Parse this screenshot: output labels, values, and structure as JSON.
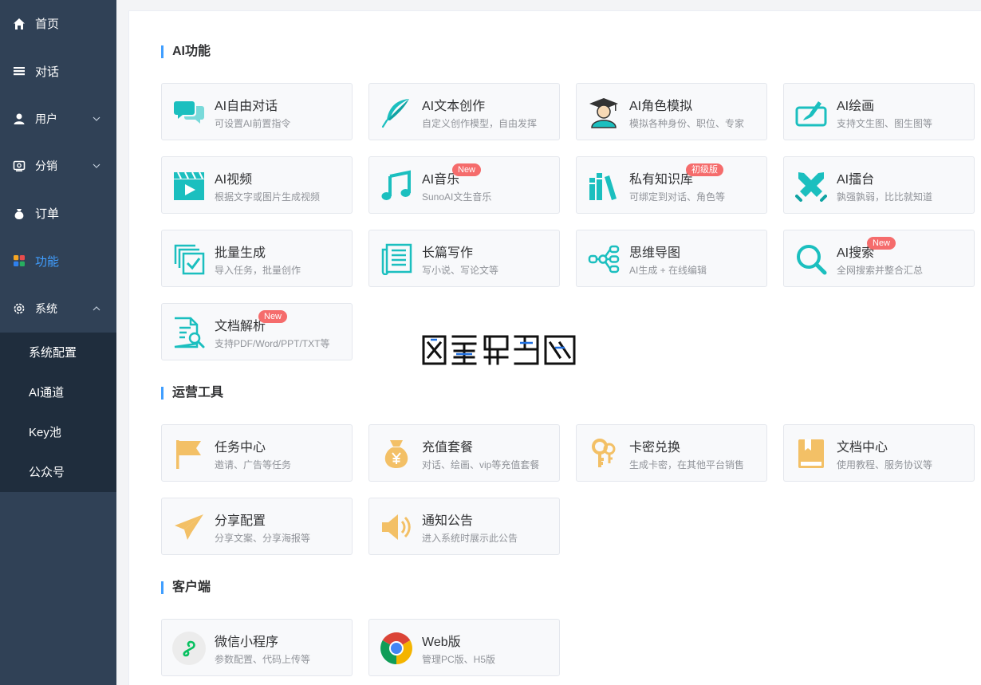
{
  "sidebar": {
    "items": [
      {
        "label": "首页",
        "icon": "home-icon"
      },
      {
        "label": "对话",
        "icon": "list-icon"
      },
      {
        "label": "用户",
        "icon": "user-icon"
      },
      {
        "label": "分销",
        "icon": "distribution-icon"
      },
      {
        "label": "订单",
        "icon": "money-bag-icon"
      },
      {
        "label": "功能",
        "icon": "grid-icon"
      },
      {
        "label": "系统",
        "icon": "gear-icon"
      }
    ],
    "submenu": [
      "系统配置",
      "AI通道",
      "Key池",
      "公众号"
    ]
  },
  "sections": {
    "ai": "AI功能",
    "ops": "运营工具",
    "client": "客户端"
  },
  "cards": {
    "chat": {
      "title": "AI自由对话",
      "desc": "可设置AI前置指令"
    },
    "write": {
      "title": "AI文本创作",
      "desc": "自定义创作模型，自由发挥"
    },
    "role": {
      "title": "AI角色模拟",
      "desc": "模拟各种身份、职位、专家"
    },
    "draw": {
      "title": "AI绘画",
      "desc": "支持文生图、图生图等"
    },
    "video": {
      "title": "AI视频",
      "desc": "根据文字或图片生成视频"
    },
    "music": {
      "title": "AI音乐",
      "desc": "SunoAI文生音乐",
      "badge": "New"
    },
    "knowledge": {
      "title": "私有知识库",
      "desc": "可绑定到对话、角色等",
      "badge": "初级版"
    },
    "arena": {
      "title": "AI擂台",
      "desc": "孰强孰弱，比比就知道"
    },
    "batch": {
      "title": "批量生成",
      "desc": "导入任务，批量创作"
    },
    "longwrite": {
      "title": "长篇写作",
      "desc": "写小说、写论文等"
    },
    "mindmap": {
      "title": "思维导图",
      "desc": "AI生成 + 在线编辑"
    },
    "search": {
      "title": "AI搜索",
      "desc": "全网搜索并整合汇总",
      "badge": "New"
    },
    "doc": {
      "title": "文档解析",
      "desc": "支持PDF/Word/PPT/TXT等",
      "badge": "New"
    },
    "task": {
      "title": "任务中心",
      "desc": "邀请、广告等任务"
    },
    "recharge": {
      "title": "充值套餐",
      "desc": "对话、绘画、vip等充值套餐"
    },
    "card": {
      "title": "卡密兑换",
      "desc": "生成卡密，在其他平台销售"
    },
    "doccenter": {
      "title": "文档中心",
      "desc": "使用教程、服务协议等"
    },
    "share": {
      "title": "分享配置",
      "desc": "分享文案、分享海报等"
    },
    "notice": {
      "title": "通知公告",
      "desc": "进入系统时展示此公告"
    },
    "wechat": {
      "title": "微信小程序",
      "desc": "参数配置、代码上传等"
    },
    "web": {
      "title": "Web版",
      "desc": "管理PC版、H5版"
    }
  },
  "colors": {
    "sidebar": "#304156",
    "submenu": "#1f2d3d",
    "accent": "#409eff",
    "teal": "#1bbfbf",
    "gold": "#f3c066",
    "badge": "#f56c6c"
  }
}
